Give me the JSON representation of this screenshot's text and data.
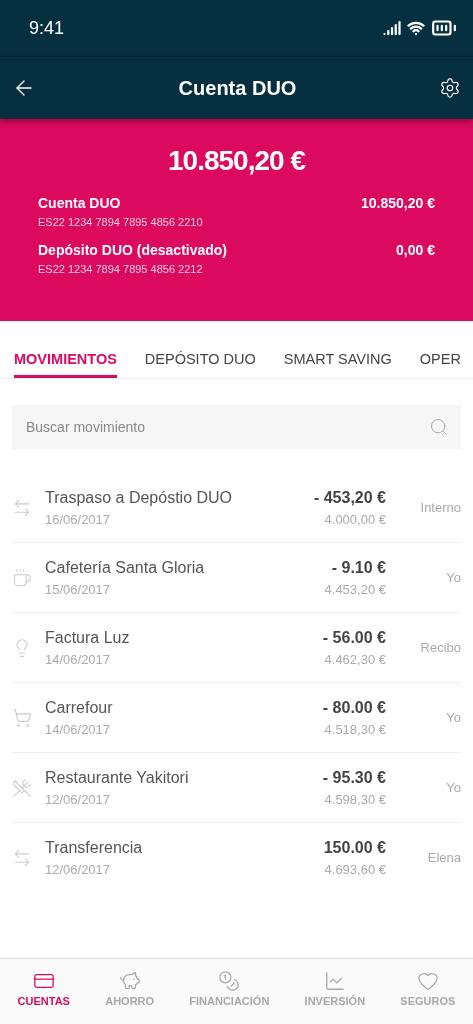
{
  "status_bar": {
    "time": "9:41"
  },
  "header": {
    "title": "Cuenta DUO"
  },
  "summary": {
    "total": "10.850,20 €",
    "accounts": [
      {
        "name": "Cuenta DUO",
        "iban": "ES22 1234 7894 7895 4856 2210",
        "amount": "10.850,20 €"
      },
      {
        "name": "Depósito DUO (desactivado)",
        "iban": "ES22 1234 7894 7895 4856 2212",
        "amount": "0,00 €"
      }
    ]
  },
  "tabs": [
    {
      "label": "MOVIMIENTOS",
      "selected": true
    },
    {
      "label": "DEPÓSITO DUO",
      "selected": false
    },
    {
      "label": "SMART SAVING",
      "selected": false
    },
    {
      "label": "OPER",
      "selected": false
    }
  ],
  "search": {
    "placeholder": "Buscar movimiento"
  },
  "movements": [
    {
      "kind": "transfer",
      "title": "Traspaso a Depóstio DUO",
      "date": "16/06/2017",
      "amount": "- 453,20 €",
      "balance": "4.000,00 €",
      "tag": "Interno"
    },
    {
      "kind": "coffee",
      "title": "Cafetería Santa Gloria",
      "date": "15/06/2017",
      "amount": "- 9.10 €",
      "balance": "4.453,20 €",
      "tag": "Yo"
    },
    {
      "kind": "bulb",
      "title": "Factura Luz",
      "date": "14/06/2017",
      "amount": "- 56.00 €",
      "balance": "4.462,30 €",
      "tag": "Recibo"
    },
    {
      "kind": "cart",
      "title": "Carrefour",
      "date": "14/06/2017",
      "amount": "- 80.00 €",
      "balance": "4.518,30 €",
      "tag": "Yo"
    },
    {
      "kind": "food",
      "title": "Restaurante Yakitori",
      "date": "12/06/2017",
      "amount": "- 95.30 €",
      "balance": "4.598,30 €",
      "tag": "Yo"
    },
    {
      "kind": "transfer",
      "title": "Transferencia",
      "date": "12/06/2017",
      "amount": "150.00 €",
      "balance": "4.693,60 €",
      "tag": "Elena"
    }
  ],
  "bottom_nav": [
    {
      "kind": "accounts",
      "label": "CUENTAS",
      "selected": true
    },
    {
      "kind": "savings",
      "label": "AHORRO",
      "selected": false
    },
    {
      "kind": "financing",
      "label": "FINANCIACIÓN",
      "selected": false
    },
    {
      "kind": "investment",
      "label": "INVERSIÓN",
      "selected": false
    },
    {
      "kind": "insurance",
      "label": "SEGUROS",
      "selected": false
    }
  ]
}
